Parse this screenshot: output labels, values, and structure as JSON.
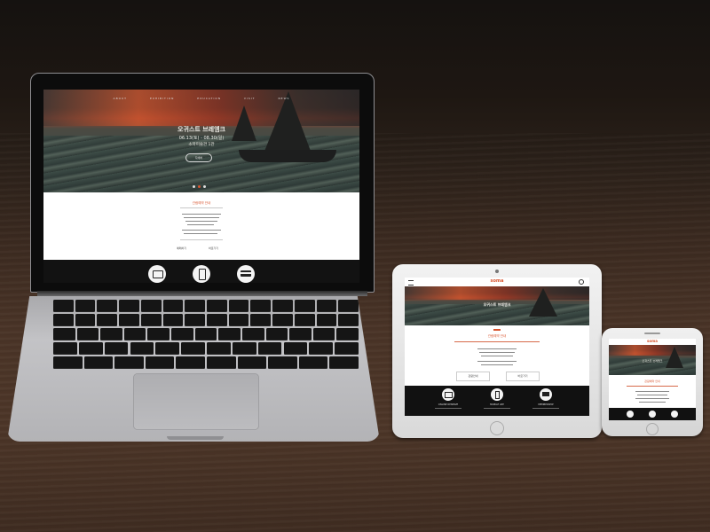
{
  "laptop": {
    "nav_items": [
      "ABOUT",
      "EXHIBITION",
      "EDUCATION",
      "VISIT",
      "NEWS"
    ],
    "hero_title": "오귀스트 브레엠크",
    "hero_dates": "06.13(토) - 08.30(일)",
    "hero_venue": "소마미술관 1관",
    "hero_button": "자세히",
    "notice_title": "관람예약 안내",
    "footer_left": "예매하기",
    "footer_right": "바로가기"
  },
  "tablet": {
    "logo": "soma",
    "notice_title": "관람예약 안내",
    "button_left": "관람안내",
    "button_right": "바로가기",
    "features": [
      {
        "title": "ONLINE RESERVE",
        "icon": "id-card-icon"
      },
      {
        "title": "MOBILE APP",
        "icon": "phone-icon"
      },
      {
        "title": "MEMBERSHIP",
        "icon": "card-icon"
      }
    ]
  },
  "phone": {
    "logo": "soma",
    "hero_title": "오귀스트 브레엠크"
  },
  "colors": {
    "accent": "#d9552f",
    "wood": "#4a3427",
    "device_silver": "#b8b8ba",
    "dark_band": "#111111"
  }
}
